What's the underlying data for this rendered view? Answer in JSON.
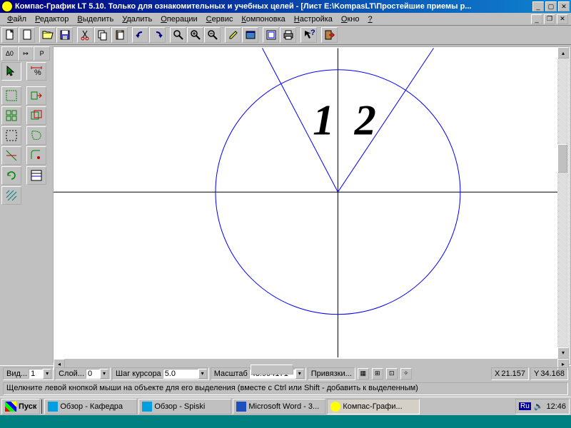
{
  "title": "Компас-График LT 5.10. Только для ознакомительных и учебных целей - [Лист E:\\KompasLT\\Простейшие приемы р...",
  "menu": [
    "Файл",
    "Редактор",
    "Выделить",
    "Удалить",
    "Операции",
    "Сервис",
    "Компоновка",
    "Настройка",
    "Окно",
    "?"
  ],
  "icons": {
    "new": "new",
    "open": "open",
    "save": "save",
    "cut": "cut",
    "copy": "copy",
    "paste": "paste",
    "undo": "undo",
    "redo": "redo",
    "zoom": "zoom",
    "zoomin": "zoomin",
    "zoomout": "zoomout",
    "pencil": "pencil",
    "window": "window",
    "page": "page",
    "print": "print",
    "info": "info",
    "help": "help",
    "exit": "exit"
  },
  "left_tabs": [
    "Δ0",
    "↦",
    "P"
  ],
  "canvas_text": {
    "one": "1",
    "two": "2"
  },
  "params": {
    "vid_lbl": "Вид...",
    "vid_val": "1",
    "sloi_lbl": "Слой...",
    "sloi_val": "0",
    "step_lbl": "Шаг курсора",
    "step_val": "5.0",
    "scale_lbl": "Масштаб",
    "scale_val": "43.994171",
    "snap_lbl": "Привязки...",
    "x_lbl": "X",
    "x_val": "21.157",
    "y_lbl": "Y",
    "y_val": "34.168"
  },
  "status": "Щелкните левой кнопкой мыши на объекте для его выделения (вместе с Ctrl или Shift - добавить к выделенным)",
  "taskbar": {
    "start": "Пуск",
    "items": [
      {
        "label": "Обзор - Кафедра",
        "active": false
      },
      {
        "label": "Обзор - Spiski",
        "active": false
      },
      {
        "label": "Microsoft Word - 3...",
        "active": false
      },
      {
        "label": "Компас-Графи...",
        "active": true
      }
    ],
    "lang": "Ru",
    "time": "12:46"
  }
}
